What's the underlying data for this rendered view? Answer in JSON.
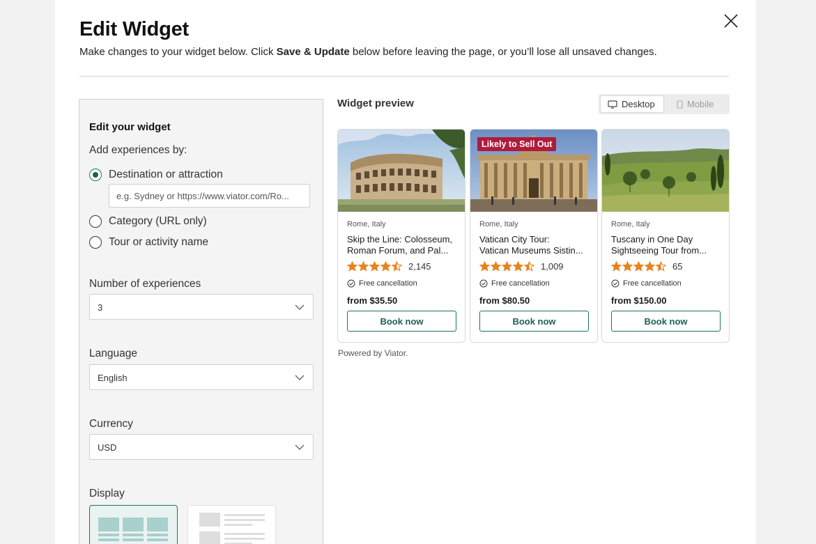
{
  "modal": {
    "title": "Edit Widget",
    "subtitle_before": "Make changes to your widget below. Click ",
    "subtitle_bold": "Save & Update",
    "subtitle_after": " below before leaving the page, or you’ll lose all unsaved changes."
  },
  "panel": {
    "heading": "Edit your widget",
    "add_label": "Add experiences by:",
    "options": [
      {
        "label": "Destination or attraction",
        "checked": true
      },
      {
        "label": "Category (URL only)",
        "checked": false
      },
      {
        "label": "Tour or activity name",
        "checked": false
      }
    ],
    "destination_placeholder": "e.g. Sydney or https://www.viator.com/Ro...",
    "number_label": "Number of experiences",
    "number_value": "3",
    "language_label": "Language",
    "language_value": "English",
    "currency_label": "Currency",
    "currency_value": "USD",
    "display_label": "Display"
  },
  "preview": {
    "title": "Widget preview",
    "desktop_label": "Desktop",
    "mobile_label": "Mobile",
    "powered_by": "Powered by Viator."
  },
  "cards": [
    {
      "location": "Rome, Italy",
      "title_line1": "Skip the Line: Colosseum,",
      "title_line2": "Roman Forum, and Pal...",
      "rating": 4.5,
      "reviews": "2,145",
      "cancellation": "Free cancellation",
      "price": "from $35.50",
      "cta": "Book now",
      "badge": ""
    },
    {
      "location": "Rome, Italy",
      "title_line1": "Vatican City Tour:",
      "title_line2": "Vatican Museums Sistin...",
      "rating": 4.5,
      "reviews": "1,009",
      "cancellation": "Free cancellation",
      "price": "from $80.50",
      "cta": "Book now",
      "badge": "Likely to Sell Out"
    },
    {
      "location": "Rome, Italy",
      "title_line1": "Tuscany in One Day",
      "title_line2": "Sightseeing Tour from...",
      "rating": 4.5,
      "reviews": "65",
      "cancellation": "Free cancellation",
      "price": "from $150.00",
      "cta": "Book now",
      "badge": ""
    }
  ],
  "colors": {
    "accent": "#1b6f6a",
    "star": "#e8821e",
    "badge": "#b01b3a"
  }
}
